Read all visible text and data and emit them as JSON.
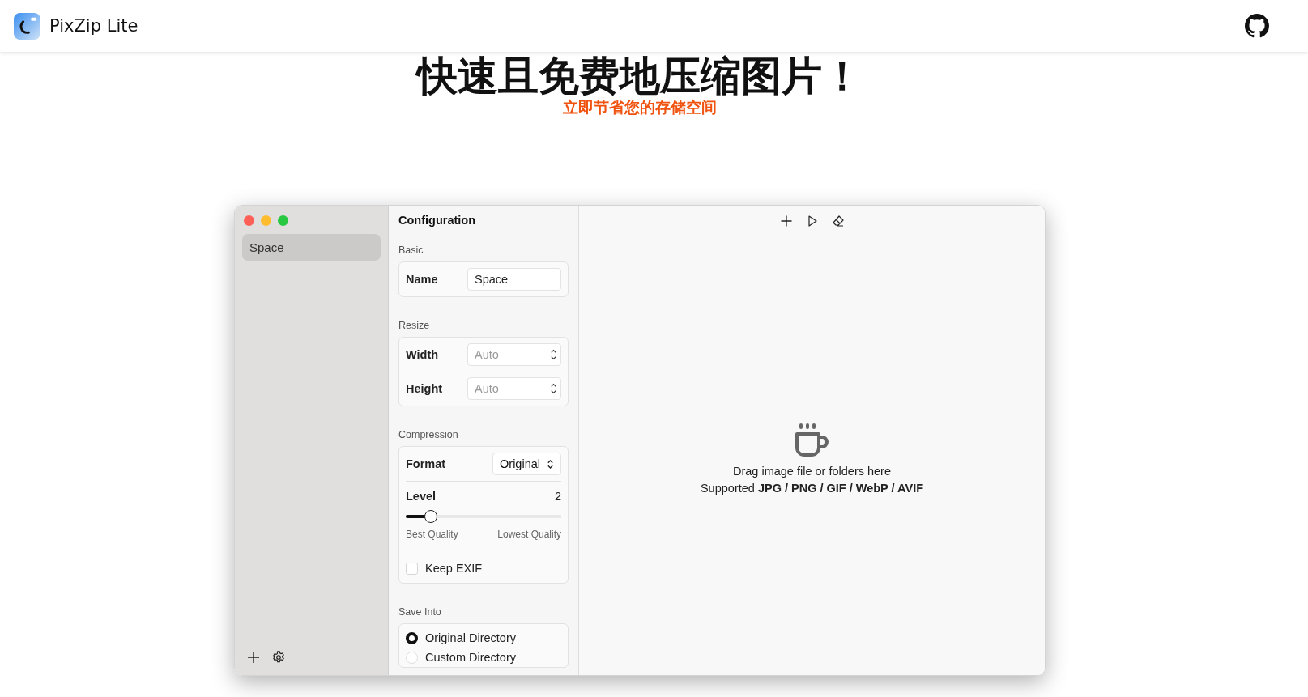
{
  "header": {
    "app_name": "PixZip Lite"
  },
  "hero": {
    "title": "快速且免费地压缩图片！",
    "subtitle": "立即节省您的存储空间"
  },
  "app_window": {
    "sidebar": {
      "items": [
        {
          "label": "Space",
          "selected": true
        }
      ]
    },
    "config": {
      "title": "Configuration",
      "sections": [
        {
          "heading": "Basic",
          "rows": [
            {
              "kind": "text",
              "label": "Name",
              "value": "Space"
            }
          ]
        },
        {
          "heading": "Resize",
          "rows": [
            {
              "kind": "number",
              "label": "Width",
              "placeholder": "Auto"
            },
            {
              "kind": "number",
              "label": "Height",
              "placeholder": "Auto"
            }
          ]
        },
        {
          "heading": "Compression",
          "rows": [
            {
              "kind": "select",
              "label": "Format",
              "value": "Original"
            },
            {
              "kind": "slider",
              "label": "Level",
              "reading": "2",
              "level": 0.16,
              "min_label": "Best Quality",
              "max_label": "Lowest Quality"
            },
            {
              "kind": "checkbox",
              "label": "Keep EXIF",
              "checked": false
            }
          ]
        },
        {
          "heading": "Save Into",
          "rows": [
            {
              "kind": "radio",
              "label": "Original Directory",
              "selected": true
            },
            {
              "kind": "radio",
              "label": "Custom Directory",
              "selected": false
            }
          ]
        }
      ]
    },
    "drop_zone": {
      "line_1": "Drag image file or folders here",
      "line_2": "Supported **JPG / PNG / GIF / WebP / AVIF**"
    }
  }
}
